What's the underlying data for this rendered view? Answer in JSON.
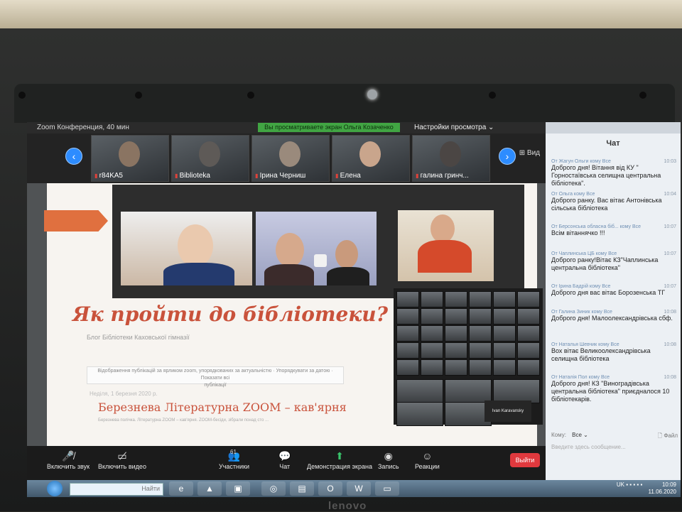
{
  "zoom": {
    "window_title": "Zoom Конференция, 40 мин",
    "viewing_banner": "Вы просматриваете экран Ольга Козаченко",
    "view_settings": "Настройки просмотра ⌄",
    "view_label": "Вид"
  },
  "thumbnails": [
    {
      "name": "r84KA5"
    },
    {
      "name": "Biblioteka"
    },
    {
      "name": "Ірина Черниш"
    },
    {
      "name": "Елена"
    },
    {
      "name": "галина гринч..."
    }
  ],
  "shared_page": {
    "heading": "Як пройти до бібліотеки?",
    "subtitle": "Блог Бібліотеки Каховської гімназії",
    "info_line_1": "Відображення публікацій за ярликом zoom, упорядкованих за актуальністю · Упорядкувати за датою · Показати всі",
    "info_line_2": "публікації",
    "date": "Неділя, 1 березня 2020 р.",
    "post_title": "Березнева Літературна ZOOM – кав'ярня",
    "post_text": "Березнева полічка. Літературна ZOOM – кав'ярня. ZOOM-бесіди, зібрали понад сто ...",
    "gallery_name": "Ivan Karavansky"
  },
  "toolbar": {
    "mute": "Включить звук",
    "video": "Включить видео",
    "participants": "Участники",
    "participants_count": "61",
    "chat": "Чат",
    "share": "Демонстрация экрана",
    "record": "Запись",
    "reactions": "Реакции",
    "leave": "Выйти"
  },
  "chat": {
    "title": "Чат",
    "messages": [
      {
        "from": "От Жагун Ольги кому Все",
        "time": "10:03",
        "text": "Доброго дня! Вітання від КУ \" Горностаївська селищна центральна бібліотека\"."
      },
      {
        "from": "От Ольга кому Все",
        "time": "10:04",
        "text": "Доброго ранку. Вас вітає Антонівська сільська бібліотека"
      },
      {
        "from": "От Берсонська обласна біб... кому Все",
        "time": "10:07",
        "text": "Всім вітаннячко !!!"
      },
      {
        "from": "От Чаплинська ЦБ кому Все",
        "time": "10:07",
        "text": "Доброго ранку!Вітає КЗ\"Чаплинська центральна бібліотека\""
      },
      {
        "from": "От Ірина Бадрій кому Все",
        "time": "10:07",
        "text": "Доброго дня вас вітає Борозенська ТГ"
      },
      {
        "from": "От Галина Зиник кому Все",
        "time": "10:08",
        "text": "Доброго дня! Малоолександрівська сбф."
      },
      {
        "from": "От Наталья Шевчик кому Все",
        "time": "10:08",
        "text": "Вох вітає Великоолександрівська селищна бібліотека"
      },
      {
        "from": "От Наталія Пол кому Все",
        "time": "10:08",
        "text": "Доброго дня! КЗ \"Виноградівська центральна бібліотека\" приєдналося 10 бібліотекарів."
      }
    ],
    "to_label": "Кому:",
    "to_value": "Все ⌄",
    "file_label": "Файл",
    "input_placeholder": "Введите здесь сообщение..."
  },
  "taskbar": {
    "search_placeholder": "Найти",
    "time": "10:09",
    "date": "11.06.2020",
    "lang": "UK"
  },
  "hardware": {
    "brand": "lenovo"
  }
}
